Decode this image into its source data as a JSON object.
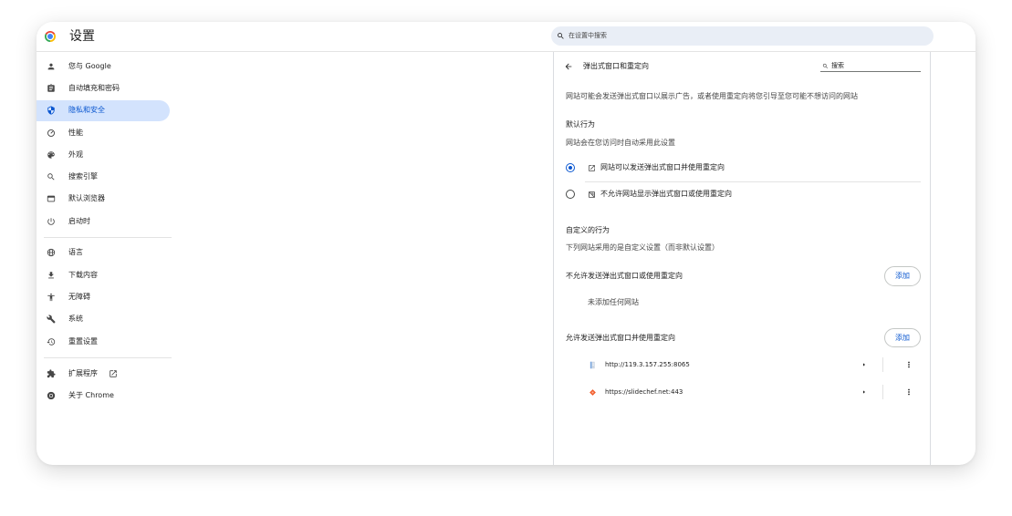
{
  "app": {
    "title": "设置",
    "logo_icon": "chrome-logo-icon"
  },
  "search": {
    "placeholder": "在设置中搜索",
    "icon": "search-icon"
  },
  "colors": {
    "accent": "#0b57d0",
    "selected_bg": "#d3e3fd",
    "search_bg": "#e9eef6",
    "text": "#1f1f1f",
    "secondary_text": "#474747",
    "divider": "#dadce0"
  },
  "sidebar": {
    "items": [
      {
        "label": "您与 Google",
        "icon": "person-icon",
        "selected": false
      },
      {
        "label": "自动填充和密码",
        "icon": "clipboard-icon",
        "selected": false
      },
      {
        "label": "隐私和安全",
        "icon": "shield-icon",
        "selected": true
      },
      {
        "label": "性能",
        "icon": "speedometer-icon",
        "selected": false
      },
      {
        "label": "外观",
        "icon": "palette-icon",
        "selected": false
      },
      {
        "label": "搜索引擎",
        "icon": "search-icon",
        "selected": false
      },
      {
        "label": "默认浏览器",
        "icon": "browser-window-icon",
        "selected": false
      },
      {
        "label": "启动时",
        "icon": "power-icon",
        "selected": false
      },
      {
        "label": "语言",
        "icon": "globe-icon",
        "selected": false
      },
      {
        "label": "下载内容",
        "icon": "download-icon",
        "selected": false
      },
      {
        "label": "无障碍",
        "icon": "accessibility-icon",
        "selected": false
      },
      {
        "label": "系统",
        "icon": "wrench-icon",
        "selected": false
      },
      {
        "label": "重置设置",
        "icon": "reset-icon",
        "selected": false
      },
      {
        "label": "扩展程序",
        "icon": "puzzle-icon",
        "selected": false,
        "trailing_icon": "open-in-new-icon"
      },
      {
        "label": "关于 Chrome",
        "icon": "chrome-icon",
        "selected": false
      }
    ]
  },
  "content": {
    "title": "弹出式窗口和重定向",
    "back_icon": "arrow-back-icon",
    "search_placeholder": "搜索",
    "description": "网站可能会发送弹出式窗口以展示广告，或者使用重定向将您引导至您可能不想访问的网站",
    "default_behavior": {
      "heading": "默认行为",
      "subheading": "网站会在您访问时自动采用此设置",
      "options": [
        {
          "label": "网站可以发送弹出式窗口并使用重定向",
          "icon": "open-in-new-icon",
          "selected": true
        },
        {
          "label": "不允许网站显示弹出式窗口或使用重定向",
          "icon": "blocked-popup-icon",
          "selected": false
        }
      ]
    },
    "custom_behavior": {
      "heading": "自定义的行为",
      "subheading": "下列网站采用的是自定义设置（而非默认设置）",
      "block": {
        "title": "不允许发送弹出式窗口或使用重定向",
        "add_label": "添加",
        "empty_text": "未添加任何网站"
      },
      "allow": {
        "title": "允许发送弹出式窗口并使用重定向",
        "add_label": "添加",
        "sites": [
          {
            "url": "http://119.3.157.255:8065",
            "favicon": "page-favicon-icon"
          },
          {
            "url": "https://slidechef.net:443",
            "favicon": "slidechef-favicon-icon"
          }
        ]
      }
    }
  }
}
